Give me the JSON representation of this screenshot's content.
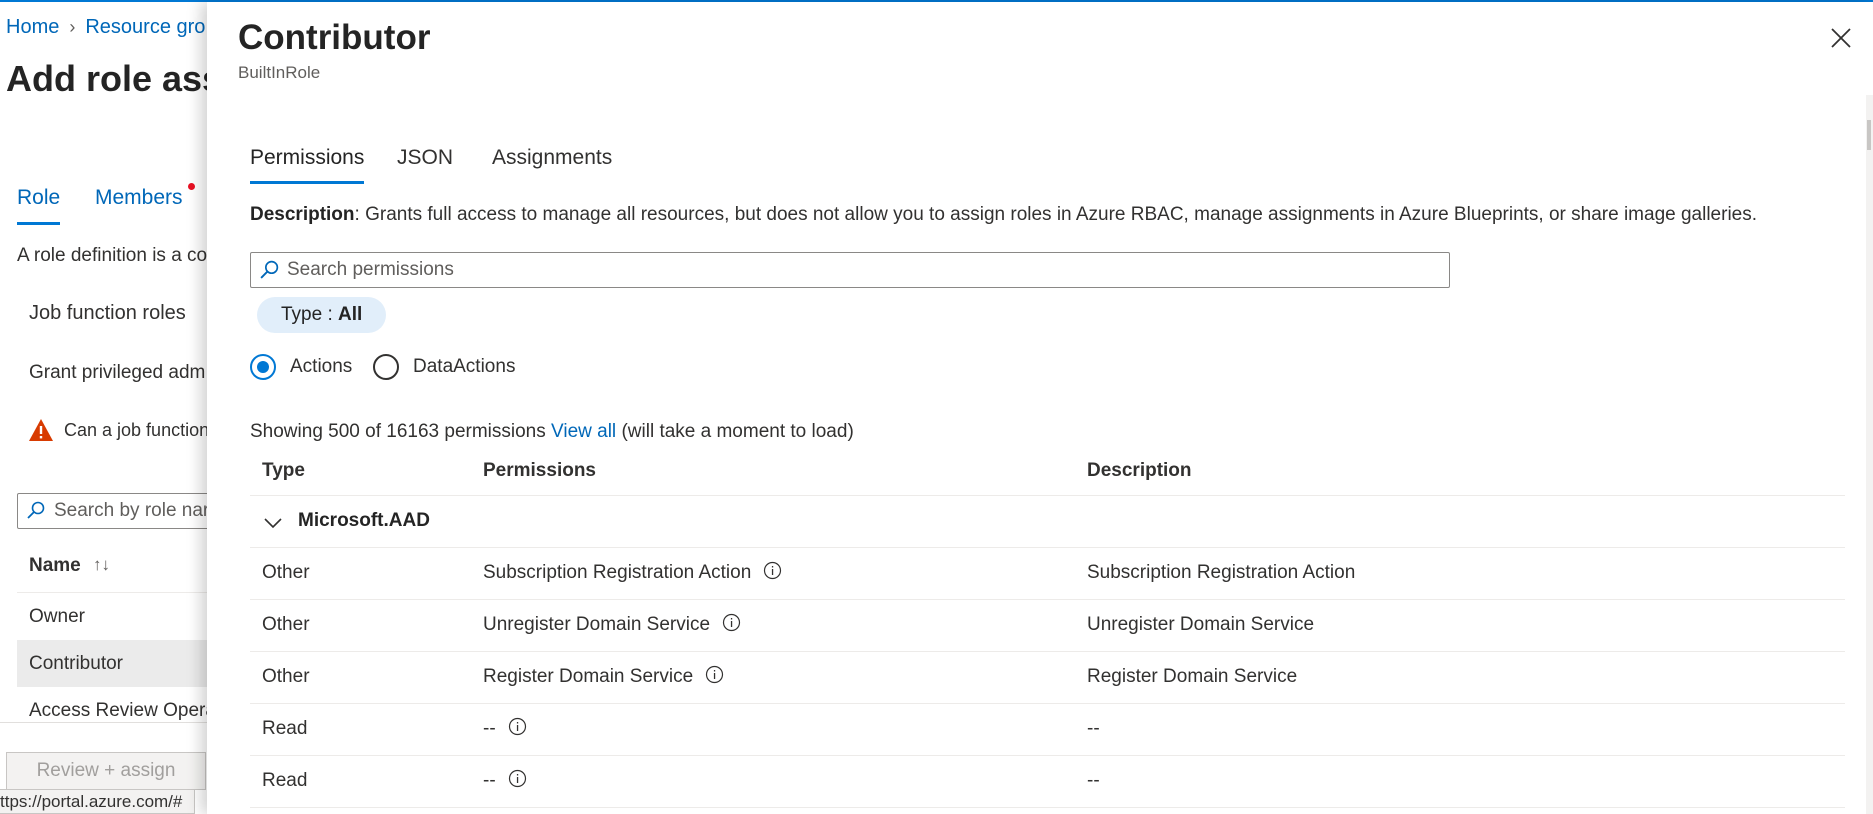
{
  "background": {
    "breadcrumb": {
      "home": "Home",
      "resource": "Resource gro"
    },
    "page_title": "Add role ass",
    "tabs": [
      {
        "label": "Role",
        "active": true
      },
      {
        "label": "Members",
        "active": false
      }
    ],
    "role_def_text": "A role definition is a co",
    "job_function_roles": "Job function roles",
    "grant_privileged": "Grant privileged adm",
    "warning_text": "Can a job function",
    "search_placeholder": "Search by role nar",
    "name_header": "Name",
    "sort_glyph": "↑↓",
    "rows": [
      "Owner",
      "Contributor",
      "Access Review Opera"
    ],
    "review_button": "Review + assign",
    "status_url": "ttps://portal.azure.com/#"
  },
  "panel": {
    "title": "Contributor",
    "subtitle": "BuiltInRole",
    "close_icon": "close-icon",
    "tabs": [
      {
        "label": "Permissions",
        "active": true
      },
      {
        "label": "JSON",
        "active": false
      },
      {
        "label": "Assignments",
        "active": false
      }
    ],
    "description_label": "Description",
    "description_text": ": Grants full access to manage all resources, but does not allow you to assign roles in Azure RBAC, manage assignments in Azure Blueprints, or share image galleries.",
    "search_placeholder": "Search permissions",
    "filter_pill": {
      "label": "Type : ",
      "value": "All"
    },
    "radios": [
      {
        "label": "Actions",
        "checked": true
      },
      {
        "label": "DataActions",
        "checked": false
      }
    ],
    "showing": {
      "prefix": "Showing 500 of 16163 permissions ",
      "link": "View all",
      "suffix": " (will take a moment to load)"
    },
    "table": {
      "headers": [
        "Type",
        "Permissions",
        "Description"
      ],
      "group": "Microsoft.AAD",
      "rows": [
        {
          "type": "Other",
          "permission": "Subscription Registration Action",
          "description": "Subscription Registration Action"
        },
        {
          "type": "Other",
          "permission": "Unregister Domain Service",
          "description": "Unregister Domain Service"
        },
        {
          "type": "Other",
          "permission": "Register Domain Service",
          "description": "Register Domain Service"
        },
        {
          "type": "Read",
          "permission": "--",
          "description": "--"
        },
        {
          "type": "Read",
          "permission": "--",
          "description": "--"
        }
      ]
    }
  },
  "colors": {
    "accent": "#0078d4",
    "link": "#0067b8",
    "warning": "#d83b01",
    "selected_row": "#ebebeb",
    "pill": "#e1eefa"
  }
}
